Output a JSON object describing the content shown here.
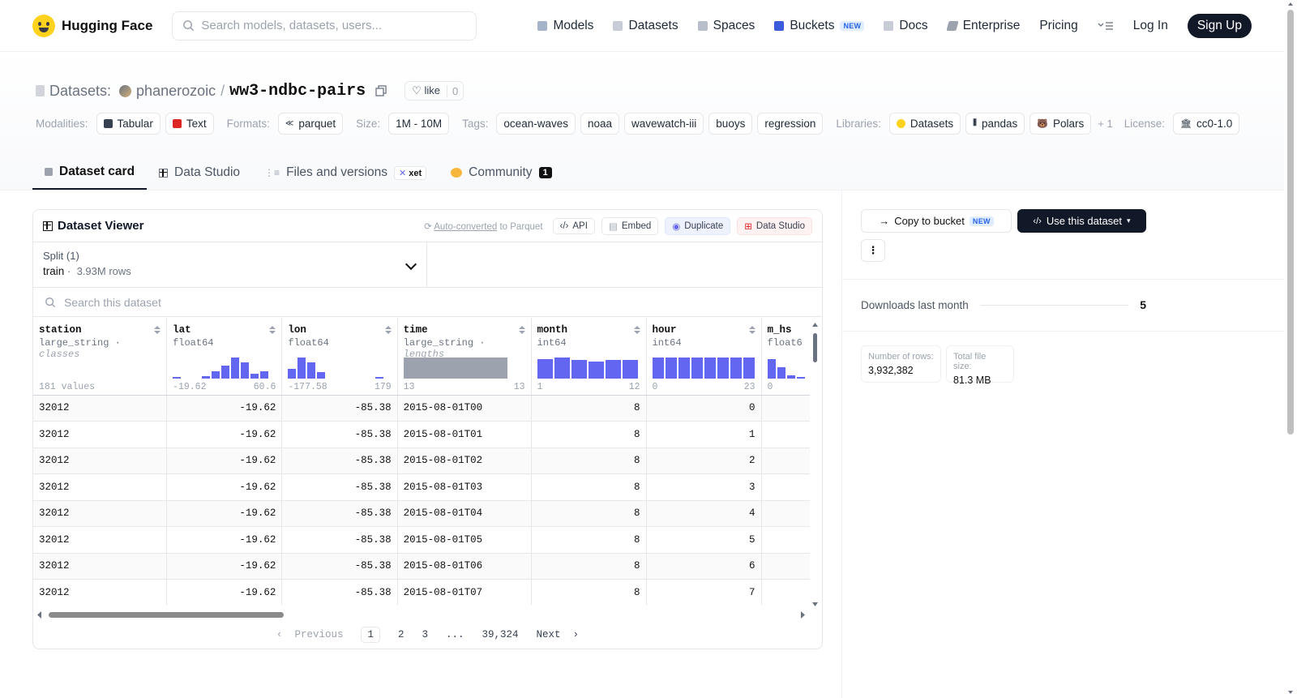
{
  "nav": {
    "brand": "Hugging Face",
    "search_placeholder": "Search models, datasets, users...",
    "links": [
      "Models",
      "Datasets",
      "Spaces",
      "Buckets",
      "Docs",
      "Enterprise",
      "Pricing"
    ],
    "buckets_badge": "NEW",
    "login": "Log In",
    "signup": "Sign Up"
  },
  "header": {
    "datasets_label": "Datasets:",
    "owner": "phanerozoic",
    "separator": "/",
    "name": "ww3-ndbc-pairs",
    "like_label": "like",
    "like_count": "0"
  },
  "tags": {
    "modalities_label": "Modalities:",
    "modalities": [
      "Tabular",
      "Text"
    ],
    "formats_label": "Formats:",
    "formats": [
      "parquet"
    ],
    "size_label": "Size:",
    "size": "1M - 10M",
    "tags_label": "Tags:",
    "tags": [
      "ocean-waves",
      "noaa",
      "wavewatch-iii",
      "buoys",
      "regression"
    ],
    "libraries_label": "Libraries:",
    "libraries": [
      "Datasets",
      "pandas",
      "Polars"
    ],
    "libraries_more": "+ 1",
    "license_label": "License:",
    "license": "cc0-1.0"
  },
  "tabs": {
    "dataset_card": "Dataset card",
    "data_studio": "Data Studio",
    "files": "Files and versions",
    "xet": "xet",
    "community": "Community",
    "community_count": "1"
  },
  "viewer": {
    "title": "Dataset Viewer",
    "auto_converted": "Auto-converted",
    "to_parquet": " to Parquet",
    "api": "API",
    "embed": "Embed",
    "duplicate": "Duplicate",
    "data_studio": "Data Studio",
    "split_label": "Split (1)",
    "split_name": "train",
    "split_rows": "3.93M rows",
    "search_placeholder": "Search this dataset",
    "columns": [
      {
        "name": "station",
        "type": "large_string",
        "type_hint": "classes",
        "summary": "181 values"
      },
      {
        "name": "lat",
        "type": "float64",
        "min": "-19.62",
        "max": "60.6"
      },
      {
        "name": "lon",
        "type": "float64",
        "min": "-177.58",
        "max": "179"
      },
      {
        "name": "time",
        "type": "large_string",
        "type_hint": "lengths",
        "min": "13",
        "max": "13"
      },
      {
        "name": "month",
        "type": "int64",
        "min": "1",
        "max": "12"
      },
      {
        "name": "hour",
        "type": "int64",
        "min": "0",
        "max": "23"
      },
      {
        "name": "m_hs",
        "type": "float6",
        "min": "0",
        "max": ""
      }
    ],
    "rows": [
      [
        "32012",
        "-19.62",
        "-85.38",
        "2015-08-01T00",
        "8",
        "0"
      ],
      [
        "32012",
        "-19.62",
        "-85.38",
        "2015-08-01T01",
        "8",
        "1"
      ],
      [
        "32012",
        "-19.62",
        "-85.38",
        "2015-08-01T02",
        "8",
        "2"
      ],
      [
        "32012",
        "-19.62",
        "-85.38",
        "2015-08-01T03",
        "8",
        "3"
      ],
      [
        "32012",
        "-19.62",
        "-85.38",
        "2015-08-01T04",
        "8",
        "4"
      ],
      [
        "32012",
        "-19.62",
        "-85.38",
        "2015-08-01T05",
        "8",
        "5"
      ],
      [
        "32012",
        "-19.62",
        "-85.38",
        "2015-08-01T06",
        "8",
        "6"
      ],
      [
        "32012",
        "-19.62",
        "-85.38",
        "2015-08-01T07",
        "8",
        "7"
      ]
    ],
    "pager": {
      "previous": "Previous",
      "pages": [
        "1",
        "2",
        "3",
        "...",
        "39,324"
      ],
      "next": "Next"
    }
  },
  "sidebar": {
    "copy_to_bucket": "Copy to bucket",
    "copy_badge": "NEW",
    "use_dataset": "Use this dataset",
    "more": "⋮",
    "downloads_label": "Downloads last month",
    "downloads_value": "5",
    "rows_label": "Number of rows:",
    "rows_value": "3,932,382",
    "size_label": "Total file size:",
    "size_value": "81.3 MB"
  },
  "colors": {
    "accent": "#6366f1",
    "primary_dark": "#111827",
    "hf_yellow": "#ffd21e"
  }
}
